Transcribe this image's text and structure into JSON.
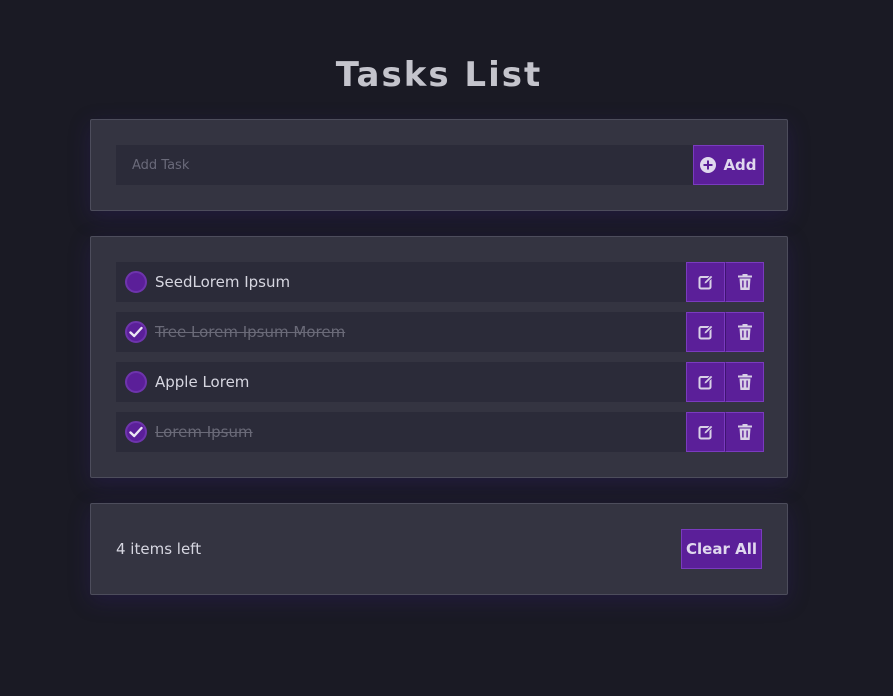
{
  "header": {
    "title": "Tasks List"
  },
  "add_form": {
    "placeholder": "Add Task",
    "value": "",
    "button_label": "Add",
    "button_icon": "plus-circle-icon"
  },
  "tasks": [
    {
      "text": "SeedLorem Ipsum",
      "completed": false
    },
    {
      "text": "Tree Lorem Ipsum Morem",
      "completed": true
    },
    {
      "text": "Apple Lorem",
      "completed": false
    },
    {
      "text": "Lorem Ipsum",
      "completed": true
    }
  ],
  "task_actions": {
    "edit_icon": "edit-icon",
    "delete_icon": "trash-icon"
  },
  "footer": {
    "items_left": "4 items left",
    "clear_label": "Clear All"
  },
  "colors": {
    "background": "#1a1a24",
    "card": "#343441",
    "accent": "#5b1f99",
    "input": "#2b2b39"
  }
}
